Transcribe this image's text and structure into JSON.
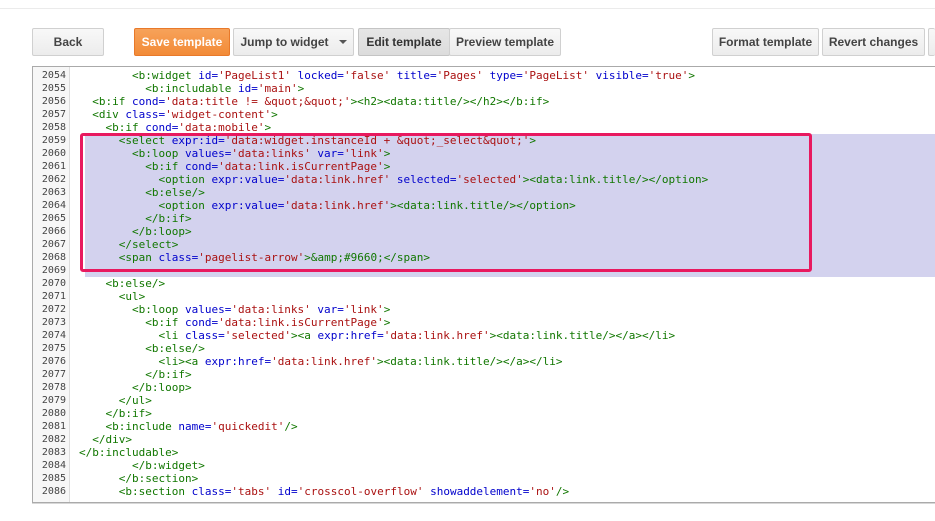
{
  "toolbar": {
    "back_label": "Back",
    "save_label": "Save template",
    "jump_label": "Jump to widget",
    "edit_label": "Edit template",
    "preview_label": "Preview template",
    "format_label": "Format template",
    "revert_label": "Revert changes"
  },
  "colors": {
    "tag": "#117700",
    "attribute": "#0000cc",
    "string": "#aa1111",
    "selection": "#d3d2ee",
    "highlight_border": "#e8195f",
    "save_button": "#f28b37"
  },
  "editor": {
    "lines": [
      {
        "n": "2054",
        "indent": "        ",
        "segs": [
          [
            "t",
            "<b:widget "
          ],
          [
            "a",
            "id="
          ],
          [
            "s",
            "'PageList1'"
          ],
          [
            "a",
            " locked="
          ],
          [
            "s",
            "'false'"
          ],
          [
            "a",
            " title="
          ],
          [
            "s",
            "'Pages'"
          ],
          [
            "a",
            " type="
          ],
          [
            "s",
            "'PageList'"
          ],
          [
            "a",
            " visible="
          ],
          [
            "s",
            "'true'"
          ],
          [
            "t",
            ">"
          ]
        ]
      },
      {
        "n": "2055",
        "indent": "          ",
        "segs": [
          [
            "t",
            "<b:includable "
          ],
          [
            "a",
            "id="
          ],
          [
            "s",
            "'main'"
          ],
          [
            "t",
            ">"
          ]
        ]
      },
      {
        "n": "2056",
        "indent": "  ",
        "segs": [
          [
            "t",
            "<b:if "
          ],
          [
            "a",
            "cond="
          ],
          [
            "s",
            "'data:title != &quot;&quot;'"
          ],
          [
            "t",
            "><h2><data:title/></h2></b:if>"
          ]
        ]
      },
      {
        "n": "2057",
        "indent": "  ",
        "segs": [
          [
            "t",
            "<div "
          ],
          [
            "a",
            "class="
          ],
          [
            "s",
            "'widget-content'"
          ],
          [
            "t",
            ">"
          ]
        ]
      },
      {
        "n": "2058",
        "indent": "    ",
        "segs": [
          [
            "t",
            "<b:if "
          ],
          [
            "a",
            "cond="
          ],
          [
            "s",
            "'data:mobile'"
          ],
          [
            "t",
            ">"
          ]
        ]
      },
      {
        "n": "2059",
        "indent": "      ",
        "sel": true,
        "segs": [
          [
            "t",
            "<select "
          ],
          [
            "a",
            "expr:id="
          ],
          [
            "s",
            "'data:widget.instanceId + &quot;_select&quot;'"
          ],
          [
            "t",
            ">"
          ]
        ]
      },
      {
        "n": "2060",
        "indent": "        ",
        "sel": true,
        "segs": [
          [
            "t",
            "<b:loop "
          ],
          [
            "a",
            "values="
          ],
          [
            "s",
            "'data:links'"
          ],
          [
            "a",
            " var="
          ],
          [
            "s",
            "'link'"
          ],
          [
            "t",
            ">"
          ]
        ]
      },
      {
        "n": "2061",
        "indent": "          ",
        "sel": true,
        "segs": [
          [
            "t",
            "<b:if "
          ],
          [
            "a",
            "cond="
          ],
          [
            "s",
            "'data:link.isCurrentPage'"
          ],
          [
            "t",
            ">"
          ]
        ]
      },
      {
        "n": "2062",
        "indent": "            ",
        "sel": true,
        "segs": [
          [
            "t",
            "<option "
          ],
          [
            "a",
            "expr:value="
          ],
          [
            "s",
            "'data:link.href'"
          ],
          [
            "a",
            " selected="
          ],
          [
            "s",
            "'selected'"
          ],
          [
            "t",
            "><data:link.title/></option>"
          ]
        ]
      },
      {
        "n": "2063",
        "indent": "          ",
        "sel": true,
        "segs": [
          [
            "t",
            "<b:else/>"
          ]
        ]
      },
      {
        "n": "2064",
        "indent": "            ",
        "sel": true,
        "segs": [
          [
            "t",
            "<option "
          ],
          [
            "a",
            "expr:value="
          ],
          [
            "s",
            "'data:link.href'"
          ],
          [
            "t",
            "><data:link.title/></option>"
          ]
        ]
      },
      {
        "n": "2065",
        "indent": "          ",
        "sel": true,
        "segs": [
          [
            "t",
            "</b:if>"
          ]
        ]
      },
      {
        "n": "2066",
        "indent": "        ",
        "sel": true,
        "segs": [
          [
            "t",
            "</b:loop>"
          ]
        ]
      },
      {
        "n": "2067",
        "indent": "      ",
        "sel": true,
        "segs": [
          [
            "t",
            "</select>"
          ]
        ]
      },
      {
        "n": "2068",
        "indent": "      ",
        "sel": true,
        "segs": [
          [
            "t",
            "<span "
          ],
          [
            "a",
            "class="
          ],
          [
            "s",
            "'pagelist-arrow'"
          ],
          [
            "t",
            ">&amp;#9660;</span>"
          ]
        ]
      },
      {
        "n": "2069",
        "indent": "",
        "sel": true,
        "segs": []
      },
      {
        "n": "2070",
        "indent": "    ",
        "segs": [
          [
            "t",
            "<b:else/>"
          ]
        ]
      },
      {
        "n": "2071",
        "indent": "      ",
        "segs": [
          [
            "t",
            "<ul>"
          ]
        ]
      },
      {
        "n": "2072",
        "indent": "        ",
        "segs": [
          [
            "t",
            "<b:loop "
          ],
          [
            "a",
            "values="
          ],
          [
            "s",
            "'data:links'"
          ],
          [
            "a",
            " var="
          ],
          [
            "s",
            "'link'"
          ],
          [
            "t",
            ">"
          ]
        ]
      },
      {
        "n": "2073",
        "indent": "          ",
        "segs": [
          [
            "t",
            "<b:if "
          ],
          [
            "a",
            "cond="
          ],
          [
            "s",
            "'data:link.isCurrentPage'"
          ],
          [
            "t",
            ">"
          ]
        ]
      },
      {
        "n": "2074",
        "indent": "            ",
        "segs": [
          [
            "t",
            "<li "
          ],
          [
            "a",
            "class="
          ],
          [
            "s",
            "'selected'"
          ],
          [
            "t",
            "><a "
          ],
          [
            "a",
            "expr:href="
          ],
          [
            "s",
            "'data:link.href'"
          ],
          [
            "t",
            "><data:link.title/></a></li>"
          ]
        ]
      },
      {
        "n": "2075",
        "indent": "          ",
        "segs": [
          [
            "t",
            "<b:else/>"
          ]
        ]
      },
      {
        "n": "2076",
        "indent": "            ",
        "segs": [
          [
            "t",
            "<li><a "
          ],
          [
            "a",
            "expr:href="
          ],
          [
            "s",
            "'data:link.href'"
          ],
          [
            "t",
            "><data:link.title/></a></li>"
          ]
        ]
      },
      {
        "n": "2077",
        "indent": "          ",
        "segs": [
          [
            "t",
            "</b:if>"
          ]
        ]
      },
      {
        "n": "2078",
        "indent": "        ",
        "segs": [
          [
            "t",
            "</b:loop>"
          ]
        ]
      },
      {
        "n": "2079",
        "indent": "      ",
        "segs": [
          [
            "t",
            "</ul>"
          ]
        ]
      },
      {
        "n": "2080",
        "indent": "    ",
        "segs": [
          [
            "t",
            "</b:if>"
          ]
        ]
      },
      {
        "n": "2081",
        "indent": "    ",
        "segs": [
          [
            "t",
            "<b:include "
          ],
          [
            "a",
            "name="
          ],
          [
            "s",
            "'quickedit'"
          ],
          [
            "t",
            "/>"
          ]
        ]
      },
      {
        "n": "2082",
        "indent": "  ",
        "segs": [
          [
            "t",
            "</div>"
          ]
        ]
      },
      {
        "n": "2083",
        "indent": "",
        "segs": [
          [
            "t",
            "</b:includable>"
          ]
        ]
      },
      {
        "n": "2084",
        "indent": "        ",
        "segs": [
          [
            "t",
            "</b:widget>"
          ]
        ]
      },
      {
        "n": "2085",
        "indent": "      ",
        "segs": [
          [
            "t",
            "</b:section>"
          ]
        ]
      },
      {
        "n": "2086",
        "indent": "      ",
        "segs": [
          [
            "t",
            "<b:section "
          ],
          [
            "a",
            "class="
          ],
          [
            "s",
            "'tabs'"
          ],
          [
            "a",
            " id="
          ],
          [
            "s",
            "'crosscol-overflow'"
          ],
          [
            "a",
            " showaddelement="
          ],
          [
            "s",
            "'no'"
          ],
          [
            "t",
            "/>"
          ]
        ]
      }
    ]
  }
}
